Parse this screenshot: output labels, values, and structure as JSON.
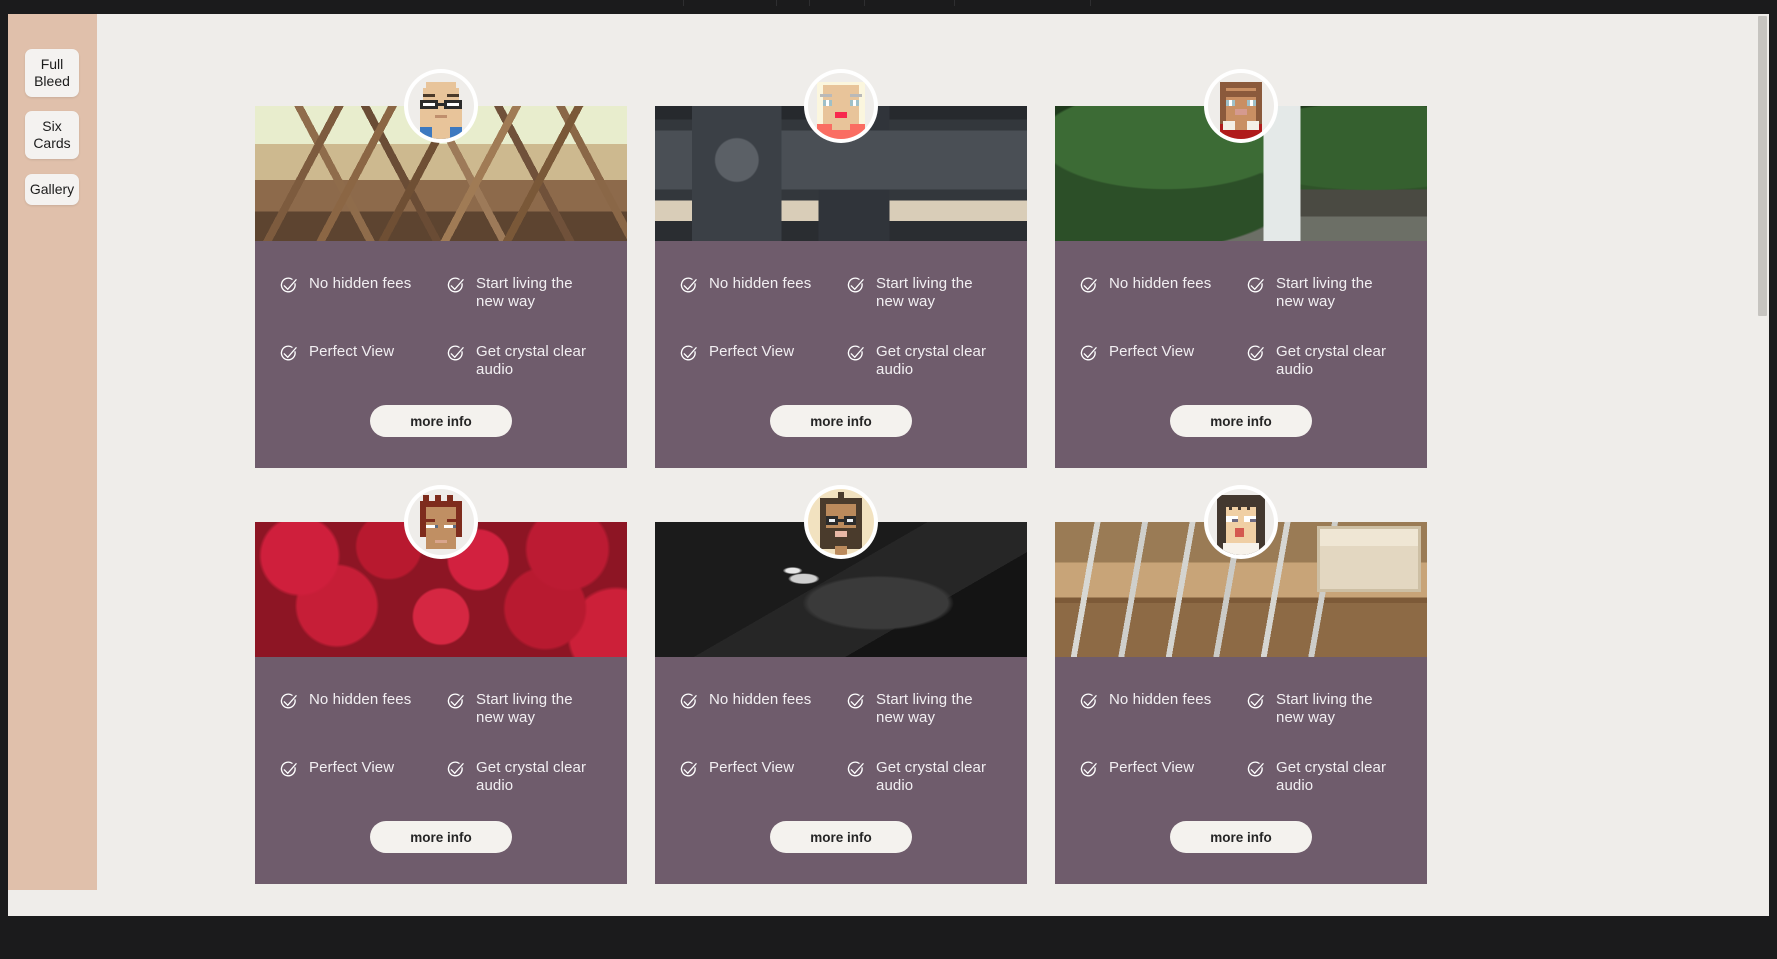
{
  "sidebar": {
    "items": [
      {
        "name": "full-bleed",
        "label": "Full\nBleed",
        "line1": "Full",
        "line2": "Bleed"
      },
      {
        "name": "six-cards",
        "label": "Six\nCards",
        "line1": "Six",
        "line2": "Cards"
      },
      {
        "name": "gallery",
        "label": "Gallery",
        "line1": "Gallery",
        "line2": ""
      }
    ],
    "background_color": "#e0c0ab"
  },
  "page": {
    "background_color": "#efedea",
    "chrome_color": "#1b1b1c"
  },
  "card": {
    "background_color": "#6f5c6c",
    "button_label": "more info",
    "features": [
      {
        "icon": "check-circle-icon",
        "label": "No hidden fees"
      },
      {
        "icon": "check-circle-icon",
        "label": "Start living the new way"
      },
      {
        "icon": "check-circle-icon",
        "label": "Perfect View"
      },
      {
        "icon": "check-circle-icon",
        "label": "Get crystal clear audio"
      }
    ]
  },
  "cards": [
    {
      "id": "card-1",
      "photo": "steel-bridge-photo",
      "avatar": "avatar-bald-man-glasses",
      "button_label": "more info",
      "features": [
        {
          "icon": "check-circle-icon",
          "label": "No hidden fees"
        },
        {
          "icon": "check-circle-icon",
          "label": "Start living the new way"
        },
        {
          "icon": "check-circle-icon",
          "label": "Perfect View"
        },
        {
          "icon": "check-circle-icon",
          "label": "Get crystal clear audio"
        }
      ]
    },
    {
      "id": "card-2",
      "photo": "desk-flatlay-photo",
      "avatar": "avatar-blonde-woman",
      "button_label": "more info",
      "features": [
        {
          "icon": "check-circle-icon",
          "label": "No hidden fees"
        },
        {
          "icon": "check-circle-icon",
          "label": "Start living the new way"
        },
        {
          "icon": "check-circle-icon",
          "label": "Perfect View"
        },
        {
          "icon": "check-circle-icon",
          "label": "Get crystal clear audio"
        }
      ]
    },
    {
      "id": "card-3",
      "photo": "waterfall-forest-photo",
      "avatar": "avatar-brown-hair-woman",
      "button_label": "more info",
      "features": [
        {
          "icon": "check-circle-icon",
          "label": "No hidden fees"
        },
        {
          "icon": "check-circle-icon",
          "label": "Start living the new way"
        },
        {
          "icon": "check-circle-icon",
          "label": "Perfect View"
        },
        {
          "icon": "check-circle-icon",
          "label": "Get crystal clear audio"
        }
      ]
    },
    {
      "id": "card-4",
      "photo": "strawberries-photo",
      "avatar": "avatar-red-hair-man",
      "button_label": "more info",
      "features": [
        {
          "icon": "check-circle-icon",
          "label": "No hidden fees"
        },
        {
          "icon": "check-circle-icon",
          "label": "Start living the new way"
        },
        {
          "icon": "check-circle-icon",
          "label": "Perfect View"
        },
        {
          "icon": "check-circle-icon",
          "label": "Get crystal clear audio"
        }
      ]
    },
    {
      "id": "card-5",
      "photo": "underwater-diver-photo",
      "avatar": "avatar-bearded-man-glasses",
      "button_label": "more info",
      "features": [
        {
          "icon": "check-circle-icon",
          "label": "No hidden fees"
        },
        {
          "icon": "check-circle-icon",
          "label": "Start living the new way"
        },
        {
          "icon": "check-circle-icon",
          "label": "Perfect View"
        },
        {
          "icon": "check-circle-icon",
          "label": "Get crystal clear audio"
        }
      ]
    },
    {
      "id": "card-6",
      "photo": "paint-brushes-photo",
      "avatar": "avatar-dark-hair-woman",
      "button_label": "more info",
      "features": [
        {
          "icon": "check-circle-icon",
          "label": "No hidden fees"
        },
        {
          "icon": "check-circle-icon",
          "label": "Start living the new way"
        },
        {
          "icon": "check-circle-icon",
          "label": "Perfect View"
        },
        {
          "icon": "check-circle-icon",
          "label": "Get crystal clear audio"
        }
      ]
    }
  ]
}
